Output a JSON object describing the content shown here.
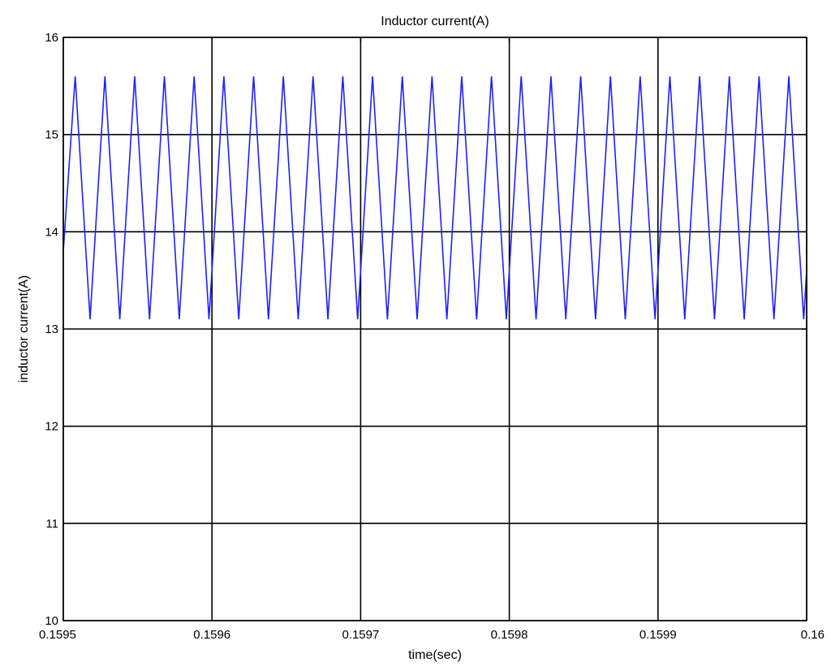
{
  "chart_data": {
    "type": "line",
    "title": "Inductor current(A)",
    "xlabel": "time(sec)",
    "ylabel": "inductor current(A)",
    "xlim": [
      0.1595,
      0.16
    ],
    "ylim": [
      10,
      16
    ],
    "x_ticks": [
      0.1595,
      0.1596,
      0.1597,
      0.1598,
      0.1599,
      0.16
    ],
    "x_tick_labels": [
      "0.1595",
      "0.1596",
      "0.1597",
      "0.1598",
      "0.1599",
      "0.16"
    ],
    "y_ticks": [
      10,
      11,
      12,
      13,
      14,
      15,
      16
    ],
    "y_tick_labels": [
      "10",
      "11",
      "12",
      "13",
      "14",
      "15",
      "16"
    ],
    "grid": true,
    "series": [
      {
        "color": "#1f1fff",
        "waveform": "triangle",
        "max": 15.6,
        "min": 13.1,
        "period": 2e-05,
        "x_start": 0.1595,
        "x_end": 0.16,
        "first_peak_x": 0.159508,
        "first_valley_x": 0.159518
      }
    ]
  }
}
